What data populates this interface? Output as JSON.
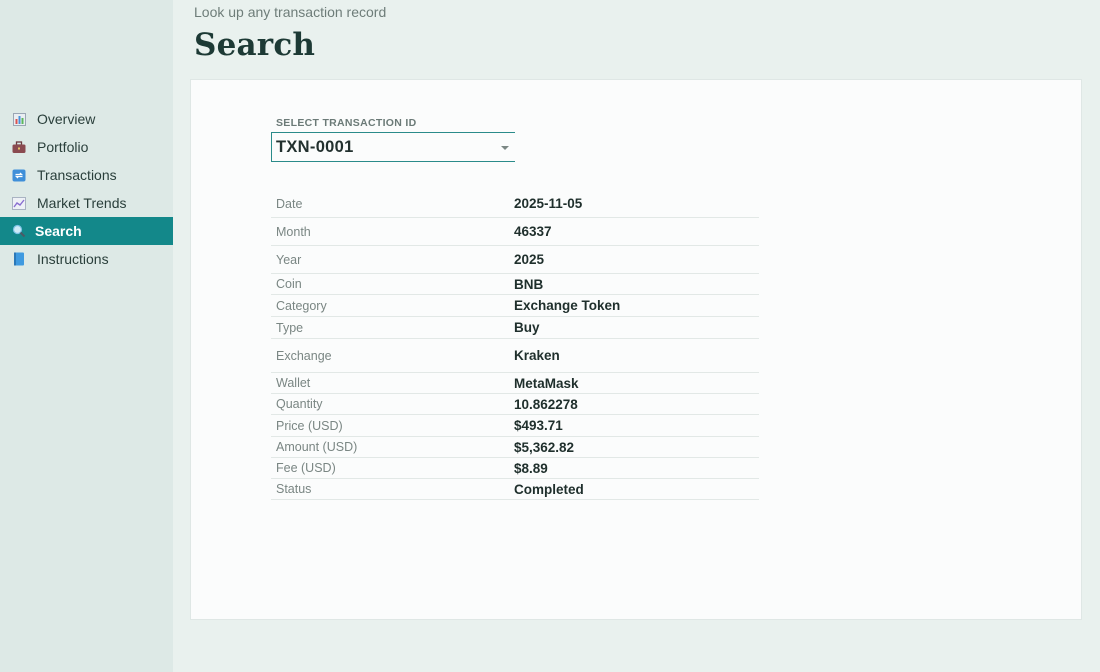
{
  "header": {
    "subtitle": "Look up any transaction record",
    "title": "Search"
  },
  "sidebar": {
    "items": [
      {
        "label": "Overview",
        "icon": "bar-chart-icon",
        "active": false
      },
      {
        "label": "Portfolio",
        "icon": "briefcase-icon",
        "active": false
      },
      {
        "label": "Transactions",
        "icon": "repeat-arrows-icon",
        "active": false
      },
      {
        "label": "Market Trends",
        "icon": "trend-line-icon",
        "active": false
      },
      {
        "label": "Search",
        "icon": "magnifier-icon",
        "active": true
      },
      {
        "label": "Instructions",
        "icon": "book-icon",
        "active": false
      }
    ]
  },
  "search": {
    "select_label": "SELECT TRANSACTION ID",
    "selected_id": "TXN-0001"
  },
  "record": {
    "fields": [
      {
        "key": "Date",
        "value": "2025-11-05"
      },
      {
        "key": "Month",
        "value": "46337"
      },
      {
        "key": "Year",
        "value": "2025"
      },
      {
        "key": "Coin",
        "value": "BNB"
      },
      {
        "key": "Category",
        "value": "Exchange Token"
      },
      {
        "key": "Type",
        "value": "Buy"
      },
      {
        "key": "Exchange",
        "value": "Kraken"
      },
      {
        "key": "Wallet",
        "value": "MetaMask"
      },
      {
        "key": "Quantity",
        "value": "10.862278"
      },
      {
        "key": "Price (USD)",
        "value": "$493.71"
      },
      {
        "key": "Amount (USD)",
        "value": "$5,362.82"
      },
      {
        "key": "Fee (USD)",
        "value": "$8.89"
      },
      {
        "key": "Status",
        "value": "Completed"
      }
    ]
  },
  "colors": {
    "accent": "#13888a",
    "sidebar_bg": "#dde9e6",
    "page_bg": "#e9f1ee",
    "card_bg": "#fbfcfc"
  }
}
